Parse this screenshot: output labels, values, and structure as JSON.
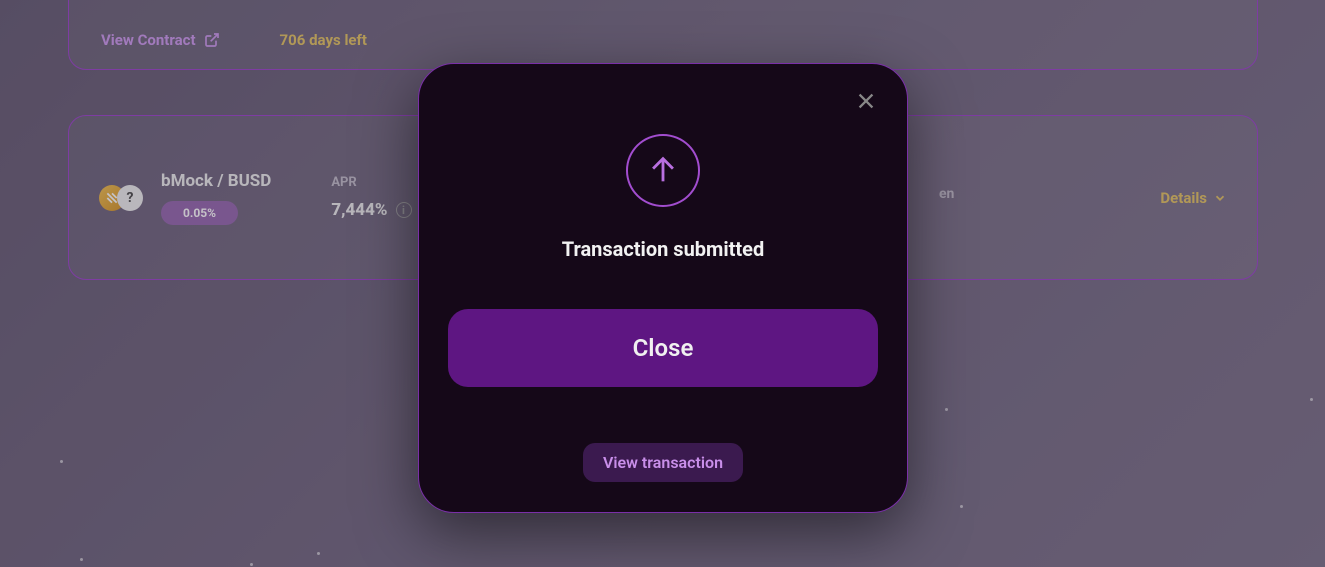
{
  "top_card": {
    "view_contract": "View Contract",
    "days_left": "706 days left"
  },
  "pool_card": {
    "pair_name": "bMock / BUSD",
    "percent_badge": "0.05%",
    "apr_label": "APR",
    "apr_value": "7,444%",
    "partial_text": "en",
    "details_label": "Details"
  },
  "modal": {
    "title": "Transaction submitted",
    "close_label": "Close",
    "view_tx_label": "View transaction"
  }
}
